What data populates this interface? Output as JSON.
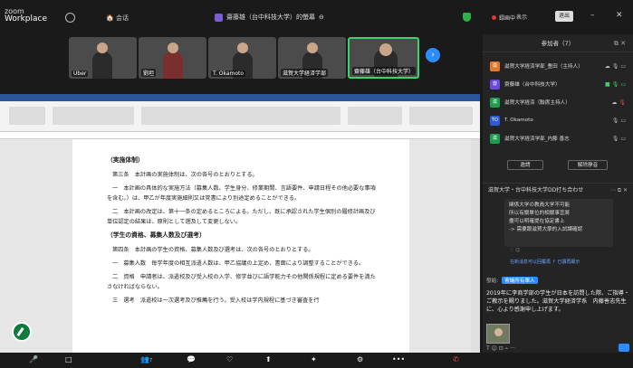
{
  "app": {
    "brand_line1": "zoom",
    "brand_line2": "Workplace",
    "home_label": "会话",
    "title": "齋藤雄（台中科技大学）的螢幕",
    "recording": "録画中",
    "view": "表示",
    "exit": "退出"
  },
  "videos": [
    {
      "name": "Uber"
    },
    {
      "name": "劉坦"
    },
    {
      "name": "T. Okamoto"
    },
    {
      "name": "滋賀大学経済学部"
    },
    {
      "name": "齋藤雄（台中科技大学）"
    }
  ],
  "document": {
    "h1": "（実施体制）",
    "art3": "第三条　本計画の実施体制は、次の各号のとおりとする。",
    "p1": "一　本計画の具体的な実施方法（募集人数、学生身分、修業期間、言語要件、申請日程その他必要な事項を含む。）は、甲乙が年度実施細則又は覚書により別途定めることができる。",
    "p2": "二　本計画の改定は、第十一条の定めるところによる。ただし、既に承認された学生個別の履修計画及び単位認定の結果は、原則として遡及して変更しない。",
    "h2": "（学生の資格、募集人数及び選考）",
    "art4": "第四条　本計画の学生の資格、募集人数及び選考は、次の各号のとおりとする。",
    "p3": "一　募集人数　毎学年度の相互派遣人数は、甲乙協議の上定め、書面により調整することができる。",
    "p4": "二　資格　申請者は、派遣校及び受入校の入学、修学並びに語学能力その他関係規程に定める要件を満たさなければならない。",
    "p5": "三　選考　派遣校は一次選考及び推薦を行う。受入校は学内規程に基づき審査を行"
  },
  "participants": {
    "header": "参加者（7）",
    "list": [
      {
        "name": "滋賀大学経済学部_豊田（主持人）",
        "color": "#e07a2a",
        "initial": "滋"
      },
      {
        "name": "齋藤雄（台中科技大学）",
        "color": "#6a4ad6",
        "initial": "齋"
      },
      {
        "name": "滋賀大学経済（聯席主持人）",
        "color": "#1d9b4f",
        "initial": "滋"
      },
      {
        "name": "T. Okamoto",
        "color": "#2d5bd6",
        "initial": "TO"
      },
      {
        "name": "滋賀大学経済学部_内藤 善志",
        "color": "#1d9b4f",
        "initial": "滋"
      }
    ],
    "invite": "邀請",
    "mute_all": "解除静音"
  },
  "chat": {
    "header": "滋賀大学・台中科技大学DD打ち合わせ",
    "box_lines": [
      "関係大学の教員大学不可能",
      "所以有關單位的相關事宜將",
      "盡可以明確提在協定書上",
      "-> 需要跟滋賀大學的入試課確認"
    ],
    "note": "在新消息可以回覆再 ↑ 已讀再顯示",
    "send_label": "發給:",
    "send_to": "會議所有單人",
    "message": "2019年に李商学部の学生が日本を訪問した際、ご指導・ご教示を賜りました。滋賀大学経済学系　内藤善志先生に、心より感謝申し上げます。"
  },
  "toolbar": {
    "mic": "🎤",
    "video": "□",
    "participants": "7",
    "chat": "💬",
    "react": "♡",
    "share": "⬆",
    "ai": "✦",
    "apps": "⚙",
    "more": "•••",
    "end": "✆"
  }
}
